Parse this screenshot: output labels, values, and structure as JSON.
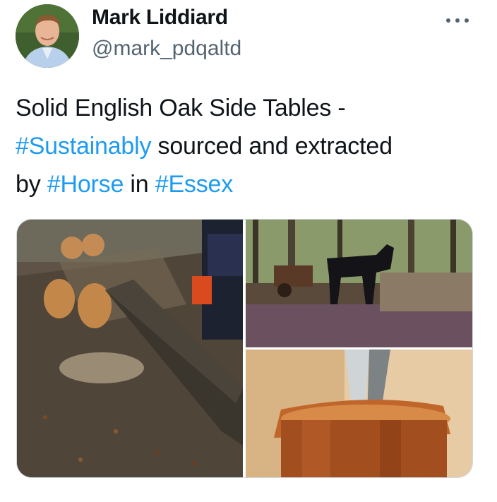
{
  "author": {
    "name": "Mark Liddiard",
    "handle": "@mark_pdqaltd"
  },
  "icons": {
    "more": "more-horizontal-icon"
  },
  "tweet": {
    "line1": "Solid English Oak Side Tables -",
    "hashtag1": "#Sustainably",
    "line2_rest": " sourced and extracted",
    "line3_by": "by ",
    "hashtag2": "#Horse",
    "line3_in": " in ",
    "hashtag3": "#Essex"
  },
  "media": {
    "count": 3
  },
  "colors": {
    "link": "#1d9bf0",
    "text": "#0f1419",
    "secondary": "#536471",
    "border": "#cfd9de"
  }
}
